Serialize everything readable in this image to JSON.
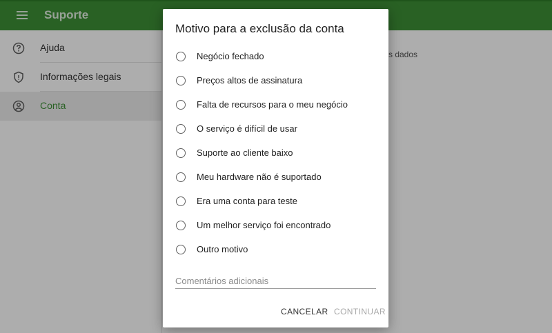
{
  "header": {
    "title": "Suporte",
    "color": "#3d8f35"
  },
  "sidebar": {
    "items": [
      {
        "label": "Ajuda",
        "icon": "help-circle-icon"
      },
      {
        "label": "Informações legais",
        "icon": "shield-icon"
      },
      {
        "label": "Conta",
        "icon": "account-circle-icon",
        "selected": true
      }
    ]
  },
  "content": {
    "partial_text": "s dados"
  },
  "dialog": {
    "title": "Motivo para a exclusão da conta",
    "options": [
      "Negócio fechado",
      "Preços altos de assinatura",
      "Falta de recursos para o meu negócio",
      "O serviço é difícil de usar",
      "Suporte ao cliente baixo",
      "Meu hardware não é suportado",
      "Era uma conta para teste",
      "Um melhor serviço foi encontrado",
      "Outro motivo"
    ],
    "comment_placeholder": "Comentários adicionais",
    "comment_value": "",
    "cancel_label": "CANCELAR",
    "continue_label": "CONTINUAR"
  }
}
